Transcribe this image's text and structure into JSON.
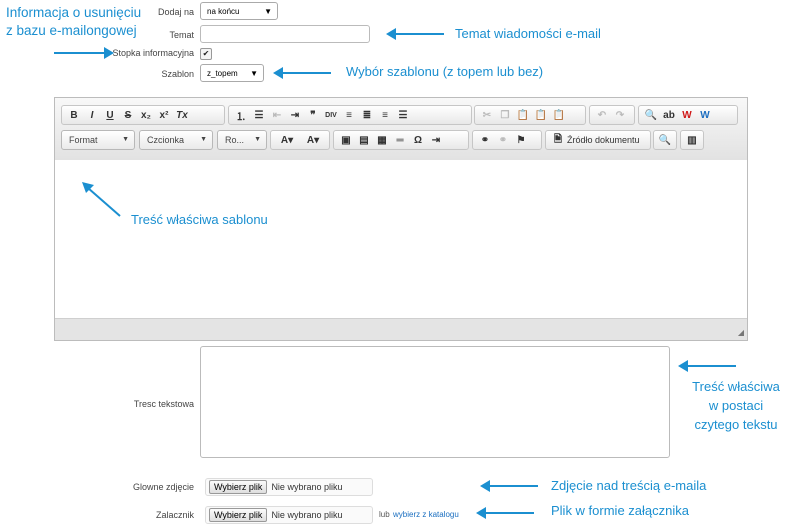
{
  "notes": {
    "deletion_info": "Informacja o usunięciu\nz bazu e-mailongowej",
    "subject": "Temat wiadomości e-mail",
    "template_choice": "Wybór szablonu (z topem lub bez)",
    "body_content": "Treść właściwa sablonu",
    "plain_text": "Treść właściwa\nw postaci\nczytego tekstu",
    "main_image": "Zdjęcie nad treścią e-maila",
    "attachment": "Plik w formie załącznika"
  },
  "form": {
    "add_on_label": "Dodaj na",
    "add_on_value": "na końcu",
    "subject_label": "Temat",
    "subject_value": "",
    "footer_label": "Stopka informacyjna",
    "footer_checked": true,
    "template_label": "Szablon",
    "template_value": "z_topem",
    "plain_text_label": "Tresc tekstowa",
    "main_image_label": "Glowne zdjęcie",
    "attachment_label": "Zalacznik",
    "file_button": "Wybierz plik",
    "file_none": "Nie wybrano pliku",
    "or_label": "lub",
    "catalog_link": "wybierz z katalogu"
  },
  "editor": {
    "format_label": "Format",
    "font_label": "Czcionka",
    "size_label": "Ro...",
    "source_label": "Źródło dokumentu",
    "colors": {
      "red_w": "#d01818",
      "blue_w": "#1f6fc0",
      "accent": "#1b8fd0"
    }
  }
}
